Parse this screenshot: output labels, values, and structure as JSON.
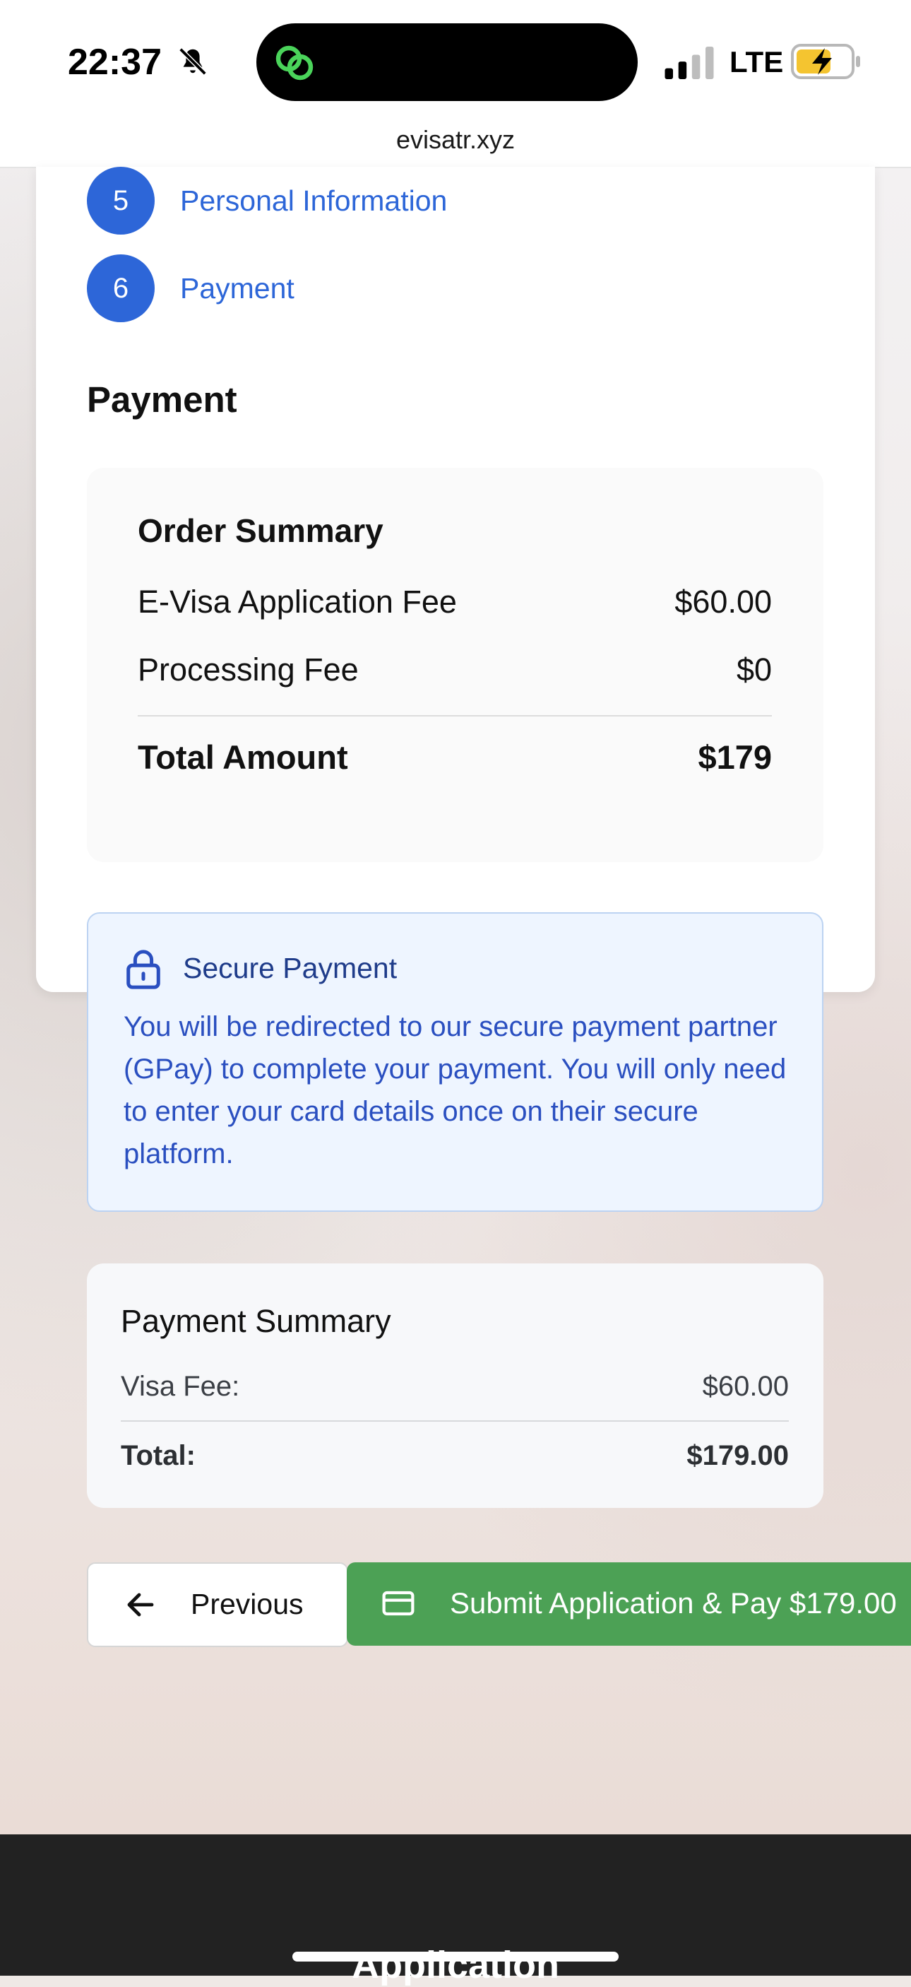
{
  "status_bar": {
    "time": "22:37",
    "network": "LTE",
    "icons": [
      "bell-slash-icon",
      "link-icon",
      "signal-icon",
      "battery-charging-icon"
    ]
  },
  "browser": {
    "url": "evisatr.xyz"
  },
  "steps": [
    {
      "number": "5",
      "label": "Personal Information"
    },
    {
      "number": "6",
      "label": "Payment"
    }
  ],
  "section_title": "Payment",
  "order_summary": {
    "title": "Order Summary",
    "rows": [
      {
        "label": "E-Visa Application Fee",
        "value": "$60.00"
      },
      {
        "label": "Processing Fee",
        "value": "$0"
      }
    ],
    "total": {
      "label": "Total Amount",
      "value": "$179"
    }
  },
  "secure_payment": {
    "title": "Secure Payment",
    "text": "You will be redirected to our secure payment partner (GPay) to complete your payment. You will only need to enter your card details once on their secure platform.",
    "icon": "lock-icon"
  },
  "payment_summary": {
    "title": "Payment Summary",
    "visa_fee": {
      "label": "Visa Fee:",
      "value": "$60.00"
    },
    "total": {
      "label": "Total:",
      "value": "$179.00"
    }
  },
  "buttons": {
    "previous": "Previous",
    "submit": "Submit Application & Pay $179.00"
  },
  "bottom_bar": {
    "text": "Application"
  },
  "colors": {
    "accent_blue": "#2d66d8",
    "submit_green": "#4ca155",
    "secure_bg": "#eef5ff"
  }
}
